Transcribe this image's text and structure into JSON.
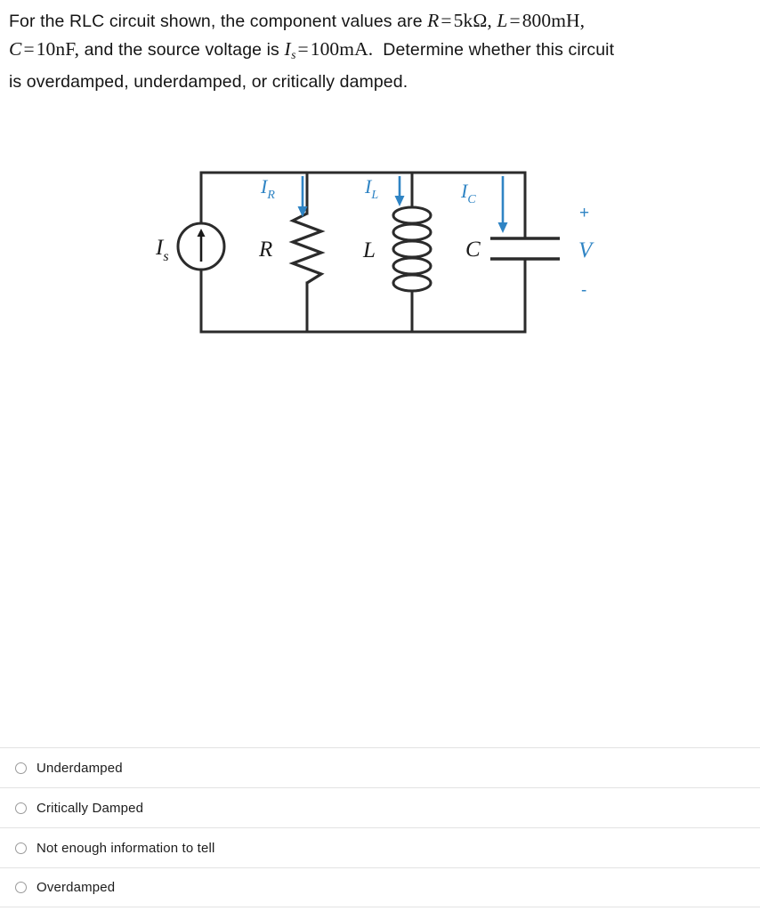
{
  "question": {
    "lines": [
      {
        "parts": [
          {
            "t": "text",
            "v": "For the RLC circuit shown, the component values are "
          },
          {
            "t": "math",
            "v": "R = 5kΩ, L = 800mH,"
          }
        ]
      },
      {
        "parts": [
          {
            "t": "math",
            "v": "C = 10nF,"
          },
          {
            "t": "text",
            "v": " and the source voltage is "
          },
          {
            "t": "math",
            "v": "Is = 100mA."
          },
          {
            "t": "text",
            "v": "  Determine whether this circuit"
          }
        ]
      },
      {
        "parts": [
          {
            "t": "text",
            "v": "is overdamped, underdamped, or critically damped."
          }
        ]
      }
    ],
    "text_line1_prefix": "For the RLC circuit shown, the component values are ",
    "math_R_symbol": "R",
    "math_R_value": "5kΩ,",
    "math_L_symbol": "L",
    "math_L_value": "800mH,",
    "math_C_symbol": "C",
    "math_C_value": "10nF,",
    "text_line2_mid": "and the source voltage is",
    "math_Is_symbol": "I",
    "math_Is_sub": "s",
    "math_Is_value": "100mA.",
    "text_line2_end": "Determine whether this circuit",
    "text_line3": "is overdamped, underdamped, or critically damped.",
    "equals": "="
  },
  "circuit": {
    "title": "RLC parallel circuit diagram",
    "source_label": "I",
    "source_sub": "s",
    "resistor_label": "R",
    "inductor_label": "L",
    "capacitor_label": "C",
    "current_R_label": "I",
    "current_R_sub": "R",
    "current_L_label": "I",
    "current_L_sub": "L",
    "current_C_label": "I",
    "current_C_sub": "C",
    "voltage_label": "V",
    "polarity_plus": "+",
    "polarity_minus": "-",
    "wire_color": "#2b2b2b",
    "arrow_color": "#2f84c4",
    "label_color": "#1a1a1a"
  },
  "choices": {
    "items": [
      {
        "label": "Underdamped",
        "selected": false
      },
      {
        "label": "Critically Damped",
        "selected": false
      },
      {
        "label": "Not enough information to tell",
        "selected": false
      },
      {
        "label": "Overdamped",
        "selected": false
      }
    ]
  }
}
